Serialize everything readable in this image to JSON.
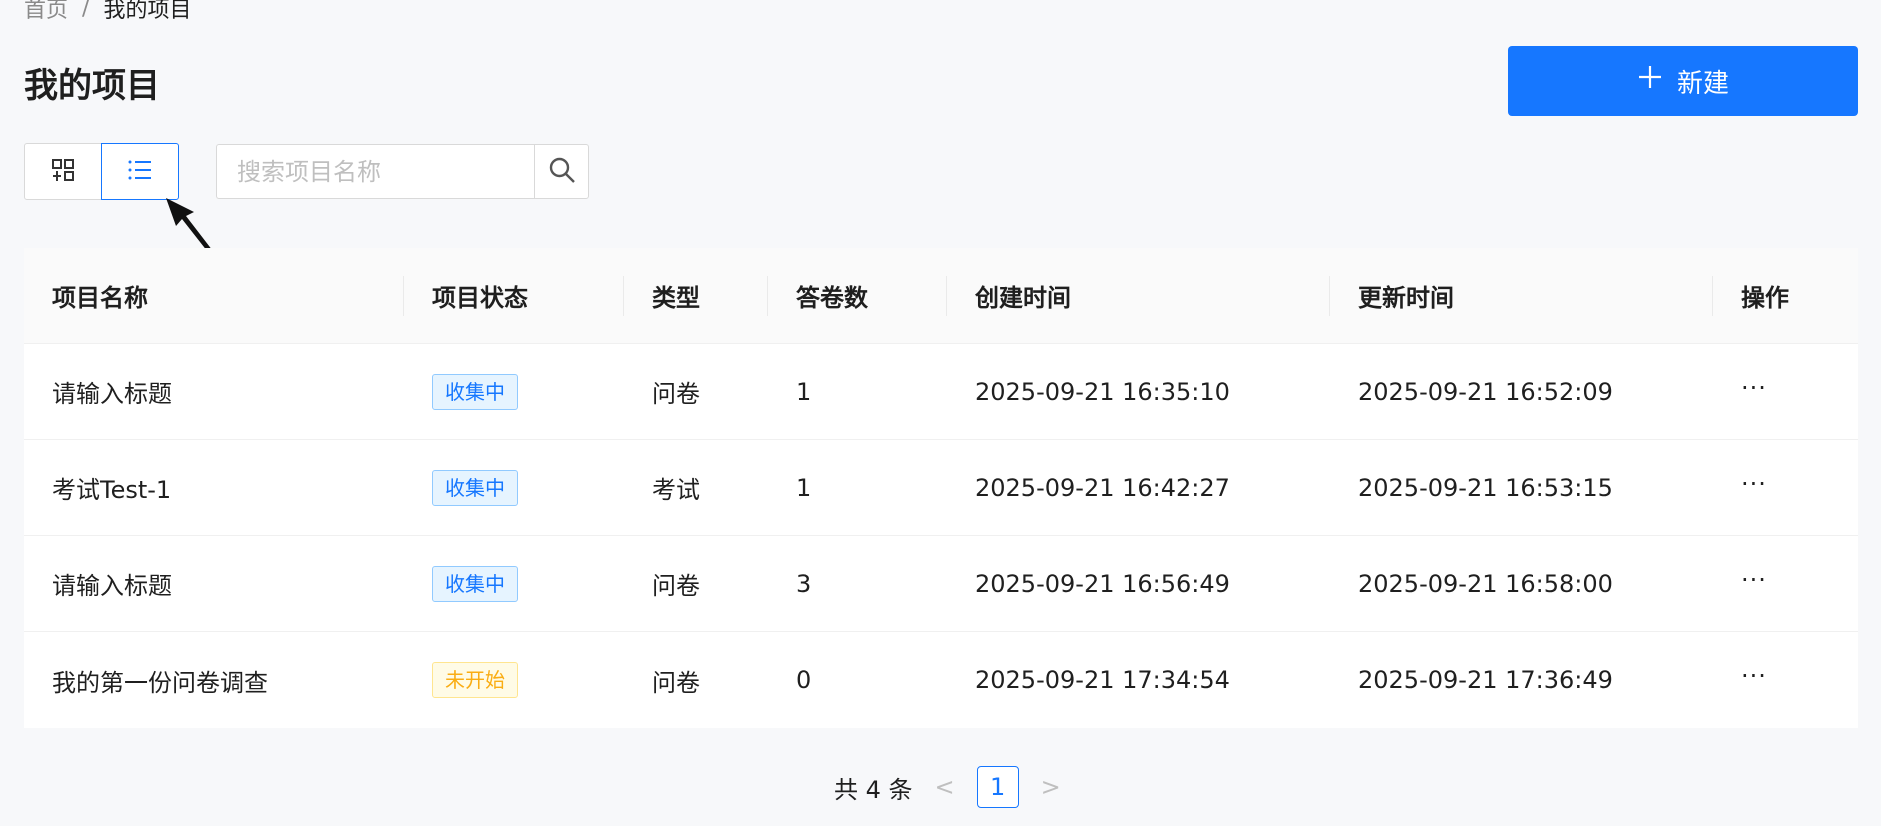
{
  "breadcrumb": {
    "home": "首页",
    "separator": "/",
    "current": "我的项目"
  },
  "page": {
    "title": "我的项目",
    "new_button_label": "新建"
  },
  "search": {
    "placeholder": "搜索项目名称",
    "value": ""
  },
  "table": {
    "headers": [
      "项目名称",
      "项目状态",
      "类型",
      "答卷数",
      "创建时间",
      "更新时间",
      "操作"
    ],
    "rows": [
      {
        "name": "请输入标题",
        "status": "收集中",
        "type": "问卷",
        "count": "1",
        "created": "2025-09-21 16:35:10",
        "updated": "2025-09-21 16:52:09",
        "action": "···"
      },
      {
        "name": "考试Test-1",
        "status": "收集中",
        "type": "考试",
        "count": "1",
        "created": "2025-09-21 16:42:27",
        "updated": "2025-09-21 16:53:15",
        "action": "···"
      },
      {
        "name": "请输入标题",
        "status": "收集中",
        "type": "问卷",
        "count": "3",
        "created": "2025-09-21 16:56:49",
        "updated": "2025-09-21 16:58:00",
        "action": "···"
      },
      {
        "name": "我的第一份问卷调查",
        "status": "未开始",
        "type": "问卷",
        "count": "0",
        "created": "2025-09-21 17:34:54",
        "updated": "2025-09-21 17:36:49",
        "action": "···"
      }
    ]
  },
  "pagination": {
    "total_label": "共 4 条",
    "prev": "<",
    "current_page": "1",
    "next": ">"
  },
  "icons": {
    "grid_view": "grid-view-icon",
    "list_view": "list-view-icon",
    "search": "search-icon",
    "plus": "plus-icon",
    "pointer": "cursor-arrow-icon"
  },
  "colors": {
    "primary": "#1677ff",
    "collecting_bg": "#e6f4ff",
    "not_started_fg": "#faad14",
    "not_started_bg": "#fffbe6"
  }
}
